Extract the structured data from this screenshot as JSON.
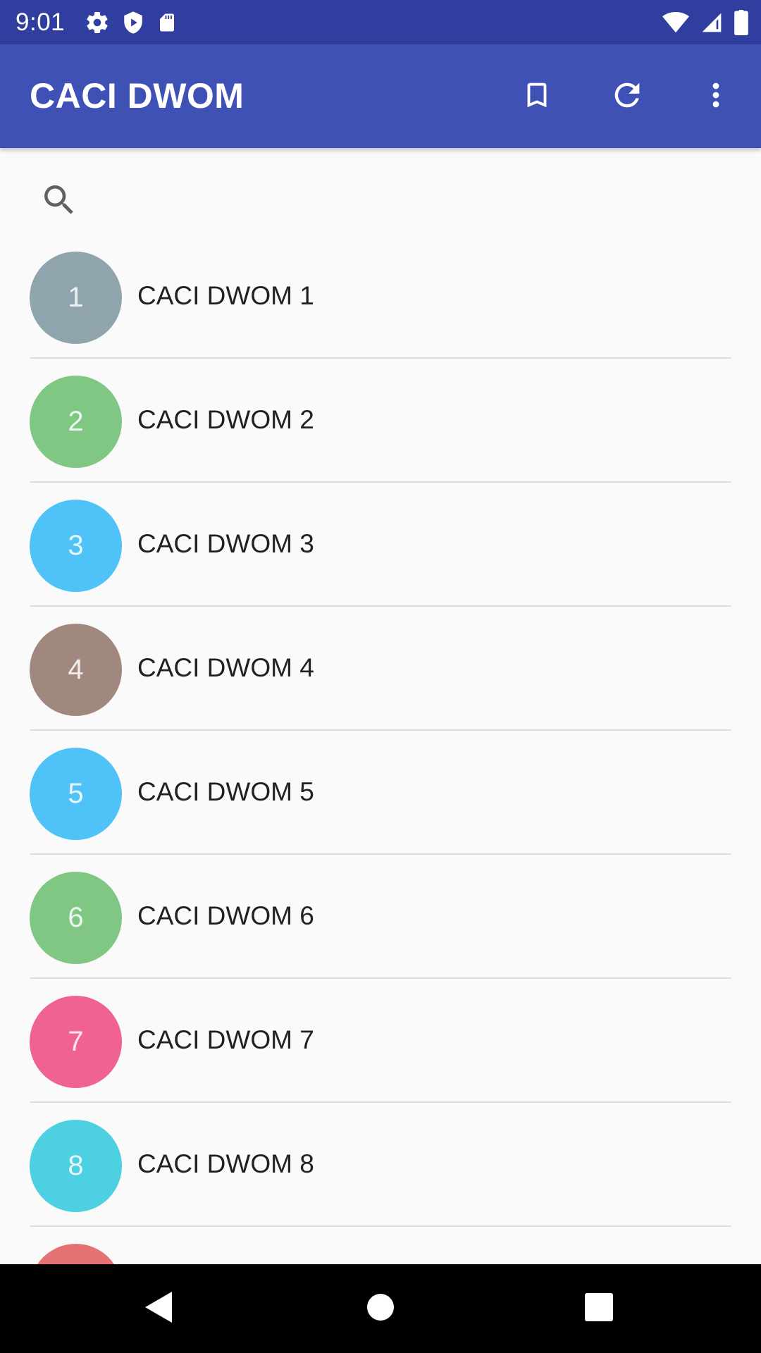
{
  "status_bar": {
    "time": "9:01",
    "left_icons": [
      "settings-icon",
      "shield-play-icon",
      "sd-card-icon"
    ],
    "right_icons": [
      "wifi-icon",
      "signal-icon",
      "battery-icon"
    ]
  },
  "app_bar": {
    "title": "CACI DWOM",
    "actions": [
      "bookmark-icon",
      "refresh-icon",
      "more-vert-icon"
    ],
    "color": "#3f51b5"
  },
  "search": {
    "placeholder": "",
    "value": ""
  },
  "list": {
    "items": [
      {
        "number": "1",
        "label": "CACI DWOM 1",
        "color": "#90a4ae"
      },
      {
        "number": "2",
        "label": "CACI DWOM 2",
        "color": "#81c784"
      },
      {
        "number": "3",
        "label": "CACI DWOM 3",
        "color": "#4fc3f7"
      },
      {
        "number": "4",
        "label": "CACI DWOM 4",
        "color": "#a1887f"
      },
      {
        "number": "5",
        "label": "CACI DWOM 5",
        "color": "#4fc3f7"
      },
      {
        "number": "6",
        "label": "CACI DWOM 6",
        "color": "#81c784"
      },
      {
        "number": "7",
        "label": "CACI DWOM 7",
        "color": "#f06292"
      },
      {
        "number": "8",
        "label": "CACI DWOM 8",
        "color": "#4dd0e1"
      },
      {
        "number": "",
        "label": "",
        "color": "#e57373"
      }
    ]
  },
  "nav_bar": {
    "buttons": [
      "back-icon",
      "home-icon",
      "recents-icon"
    ]
  }
}
